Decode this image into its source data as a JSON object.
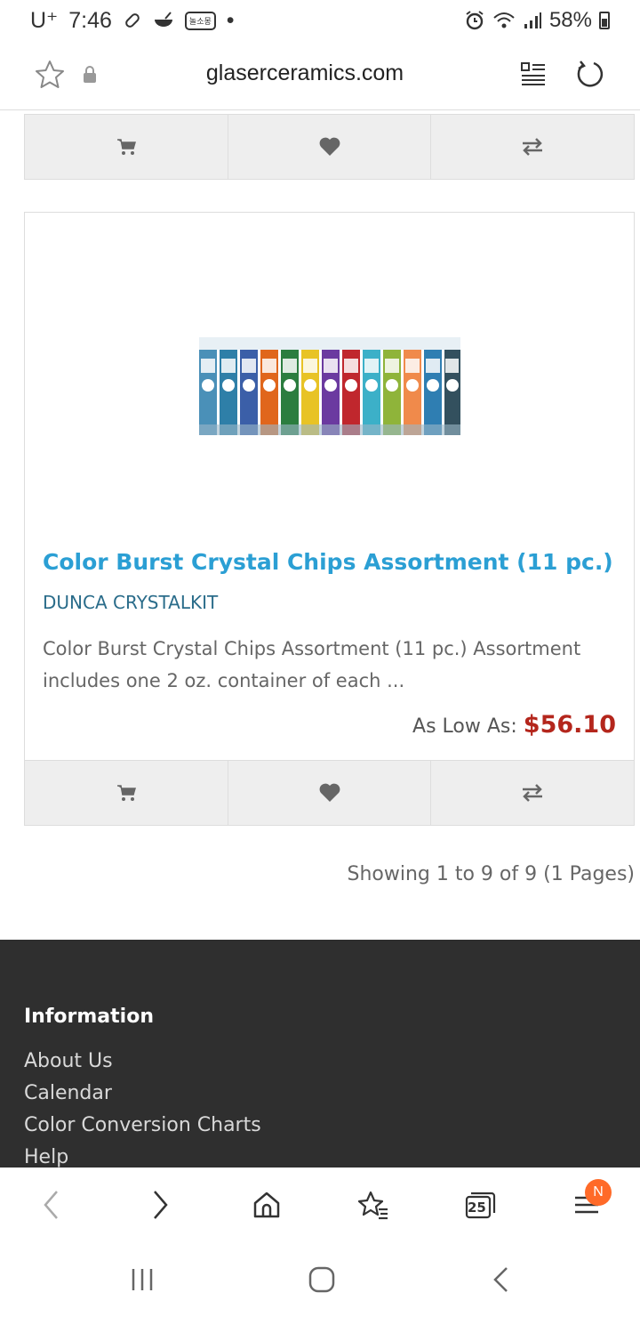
{
  "status_bar": {
    "carrier": "U⁺",
    "time": "7:46",
    "notif_label": "놀소몽",
    "battery": "58%"
  },
  "browser": {
    "url": "glaserceramics.com",
    "tabs_count": "25",
    "menu_badge": "N"
  },
  "product": {
    "title": "Color Burst Crystal Chips Assortment (11 pc.)",
    "sku": "DUNCA CRYSTALKIT",
    "description": "Color Burst Crystal Chips Assortment (11 pc.) Assortment includes one 2 oz. container of each ...",
    "price_label": "As Low As:",
    "price": "$56.10"
  },
  "pagination": "Showing 1 to 9 of 9 (1 Pages)",
  "footer": {
    "heading": "Information",
    "links": [
      "About Us",
      "Calendar",
      "Color Conversion Charts",
      "Help"
    ]
  },
  "colors": {
    "title": "#2b9fd4",
    "sku": "#2a6c8a",
    "price": "#b4261c",
    "footer_bg": "#2f2f2f",
    "badge": "#ff6a28"
  },
  "icons": [
    "cart-icon",
    "heart-icon",
    "compare-icon",
    "star-icon",
    "lock-icon",
    "reader-icon",
    "reload-icon",
    "back-icon",
    "forward-icon",
    "home-icon",
    "bookmarks-icon",
    "tabs-icon",
    "menu-icon"
  ]
}
